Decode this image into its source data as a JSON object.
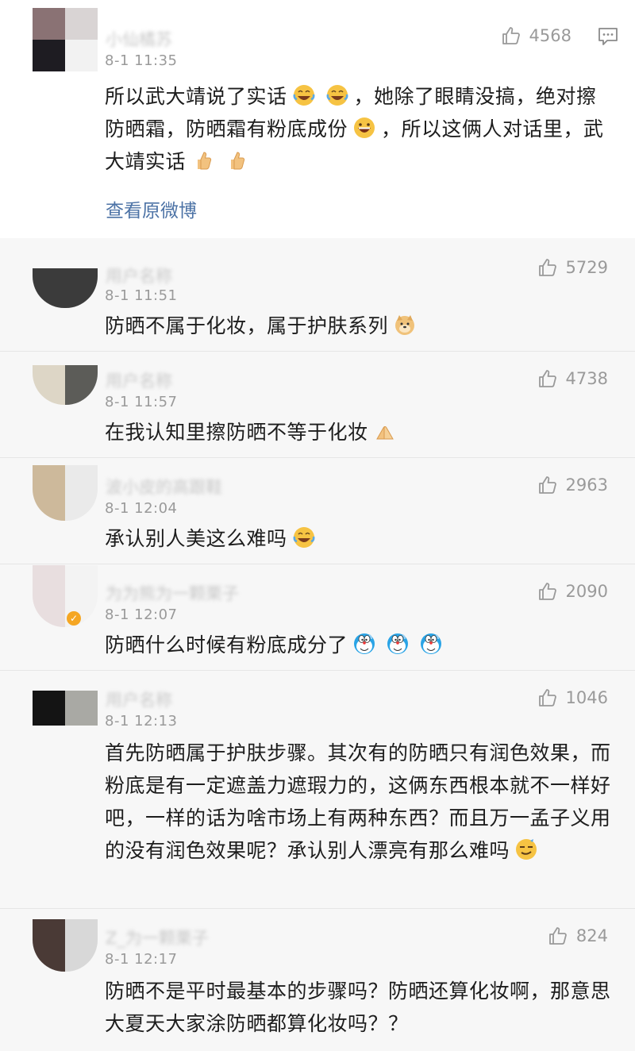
{
  "top_comment": {
    "username": "小仙橘苏",
    "timestamp": "8-1 11:35",
    "likes": "4568",
    "text_parts": [
      "所以武大靖说了实话",
      "，她除了眼睛没搞，绝对擦防晒霜，防晒霜有粉底成份",
      "，所以这俩人对话里，武大靖实话"
    ],
    "view_original_label": "查看原微博"
  },
  "replies": [
    {
      "username": "用户名称",
      "timestamp": "8-1 11:51",
      "likes": "5729",
      "text": "防晒不属于化妆，属于护肤系列"
    },
    {
      "username": "用户名称",
      "timestamp": "8-1 11:57",
      "likes": "4738",
      "text": "在我认知里擦防晒不等于化妆"
    },
    {
      "username": "波小皮的高跟鞋",
      "timestamp": "8-1 12:04",
      "likes": "2963",
      "text": "承认别人美这么难吗"
    },
    {
      "username": "为为熊为一颗栗子",
      "timestamp": "8-1 12:07",
      "likes": "2090",
      "text": "防晒什么时候有粉底成分了"
    },
    {
      "username": "用户名称",
      "timestamp": "8-1 12:13",
      "likes": "1046",
      "text": "首先防晒属于护肤步骤。其次有的防晒只有润色效果，而粉底是有一定遮盖力遮瑕力的，这俩东西根本就不一样好吧，一样的话为啥市场上有两种东西？而且万一孟子义用的没有润色效果呢？承认别人漂亮有那么难吗"
    },
    {
      "username": "Z_为一颗栗子",
      "timestamp": "8-1 12:17",
      "likes": "824",
      "text": "防晒不是平时最基本的步骤吗？防晒还算化妆啊，那意思大夏天大家涂防晒都算化妆吗？？"
    }
  ],
  "icons": {
    "like": "thumbs-up-icon",
    "comment": "comment-icon",
    "emoji_laugh_cry": "laugh-cry-emoji",
    "emoji_grin": "grin-emoji",
    "emoji_thumb": "thumbs-up-emoji",
    "emoji_doge": "doge-emoji",
    "emoji_pray": "pray-emoji",
    "emoji_doraemon": "doraemon-emoji",
    "emoji_smug": "smug-emoji"
  },
  "colors": {
    "link": "#4d73a6",
    "meta": "#9a9a9a",
    "emoji": "#f6c343"
  }
}
